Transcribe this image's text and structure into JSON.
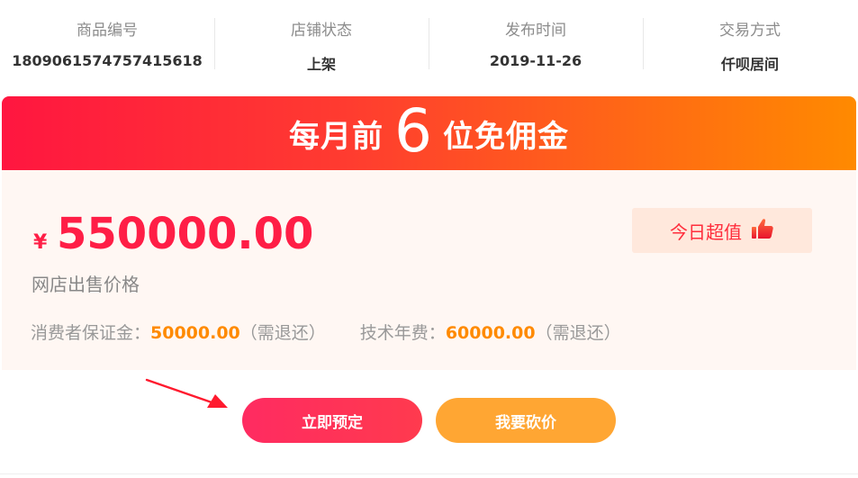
{
  "info": [
    {
      "label": "商品编号",
      "value": "1809061574757415618"
    },
    {
      "label": "店铺状态",
      "value": "上架"
    },
    {
      "label": "发布时间",
      "value": "2019-11-26"
    },
    {
      "label": "交易方式",
      "value": "仟呗居间"
    }
  ],
  "banner": {
    "prefix": "每月前",
    "number": "6",
    "suffix": "位免佣金"
  },
  "price": {
    "currency": "¥",
    "amount": "550000.00",
    "label": "网店出售价格"
  },
  "fees": {
    "deposit_label": "消费者保证金：",
    "deposit_value": "50000.00",
    "deposit_note": "（需退还）",
    "tech_label": "技术年费：",
    "tech_value": "60000.00",
    "tech_note": "（需退还）"
  },
  "badge": {
    "label": "今日超值",
    "icon": "thumbs-up-icon"
  },
  "buttons": {
    "reserve": "立即预定",
    "bargain": "我要砍价"
  },
  "colors": {
    "primary": "#ff1e46",
    "accent": "#ff8a00",
    "bargain": "#ffa633"
  }
}
